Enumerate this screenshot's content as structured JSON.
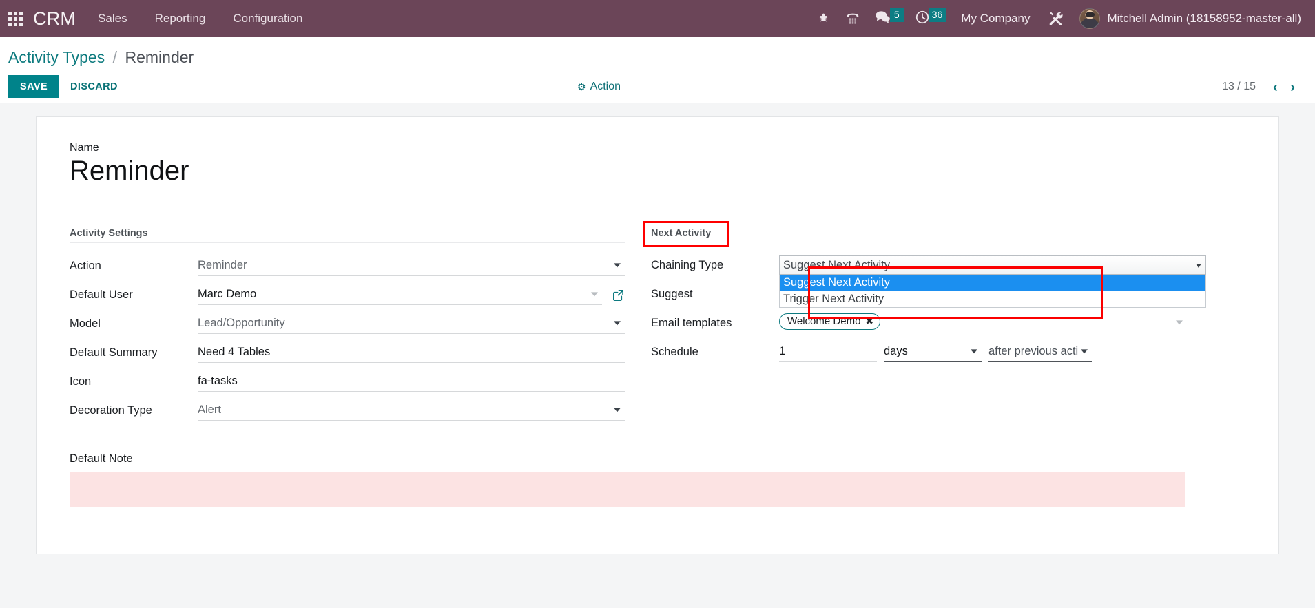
{
  "navbar": {
    "apps_icon": "apps-grid-icon",
    "brand": "CRM",
    "menus": [
      "Sales",
      "Reporting",
      "Configuration"
    ],
    "icons": [
      {
        "name": "bug-icon",
        "glyph": "bug"
      },
      {
        "name": "phone-dialpad-icon",
        "glyph": "phone"
      }
    ],
    "messages": {
      "icon": "chat-bubble-icon",
      "badge": "5"
    },
    "activities": {
      "icon": "clock-icon",
      "badge": "36"
    },
    "company": "My Company",
    "settings_icon": "tools-icon",
    "user": "Mitchell Admin (18158952-master-all)",
    "accent": "#6b4558",
    "badge_color": "#0d7d84"
  },
  "breadcrumb": {
    "root": "Activity Types",
    "separator": "/",
    "current": "Reminder"
  },
  "controls": {
    "save": "SAVE",
    "discard": "DISCARD",
    "action": "Action",
    "action_icon": "gear-icon",
    "pager_count": "13 / 15",
    "prev_icon": "‹",
    "next_icon": "›",
    "teal": "#00838a"
  },
  "form": {
    "name_label": "Name",
    "name_value": "Reminder",
    "left_group_title": "Activity Settings",
    "left_fields": [
      {
        "label": "Action",
        "value": "Reminder",
        "type": "select",
        "muted": true
      },
      {
        "label": "Default User",
        "value": "Marc Demo",
        "type": "select-link",
        "muted": false
      },
      {
        "label": "Model",
        "value": "Lead/Opportunity",
        "type": "select",
        "muted": true
      },
      {
        "label": "Default Summary",
        "value": "Need 4 Tables",
        "type": "text",
        "muted": false
      },
      {
        "label": "Icon",
        "value": "fa-tasks",
        "type": "text",
        "muted": false
      },
      {
        "label": "Decoration Type",
        "value": "Alert",
        "type": "select",
        "muted": true
      }
    ],
    "right_group_title": "Next Activity",
    "chaining": {
      "label": "Chaining Type",
      "selected": "Suggest Next Activity",
      "options": [
        "Suggest Next Activity",
        "Trigger Next Activity"
      ]
    },
    "suggest_label": "Suggest",
    "email_templates": {
      "label": "Email templates",
      "tags": [
        "Welcome Demo"
      ],
      "tag_remove_icon": "✖"
    },
    "schedule": {
      "label": "Schedule",
      "amount": "1",
      "unit": "days",
      "reference": "after previous acti"
    },
    "note_label": "Default Note",
    "note_value": ""
  }
}
